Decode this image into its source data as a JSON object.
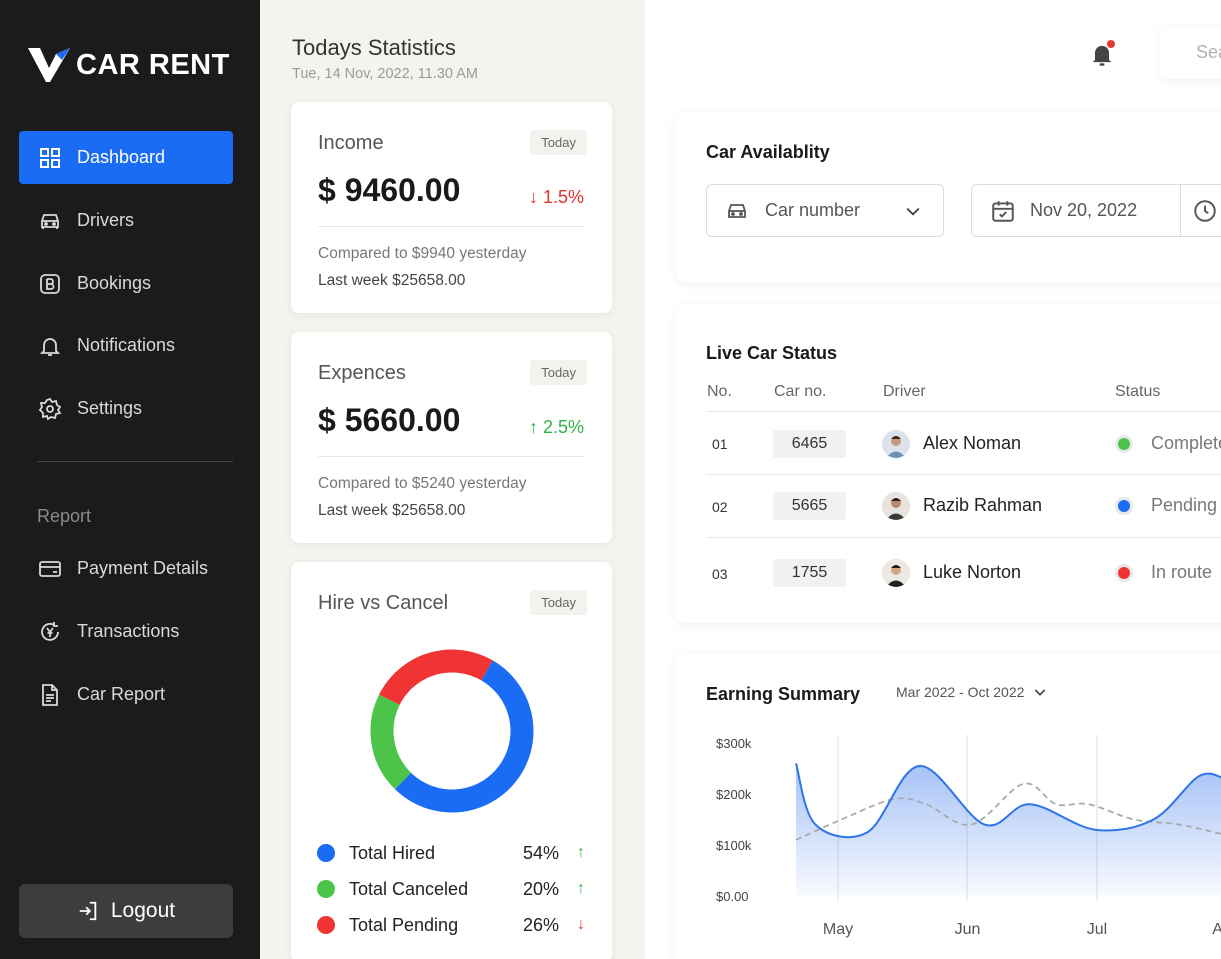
{
  "app": {
    "brand": "CAR RENT"
  },
  "sidebar": {
    "items": [
      {
        "label": "Dashboard",
        "icon": "grid-icon",
        "active": true
      },
      {
        "label": "Drivers",
        "icon": "car-icon"
      },
      {
        "label": "Bookings",
        "icon": "bookings-icon"
      },
      {
        "label": "Notifications",
        "icon": "bell-icon"
      },
      {
        "label": "Settings",
        "icon": "gear-icon"
      }
    ],
    "report_label": "Report",
    "report_items": [
      {
        "label": "Payment Details",
        "icon": "wallet-icon"
      },
      {
        "label": "Transactions",
        "icon": "yen-coin-icon"
      },
      {
        "label": "Car Report",
        "icon": "document-icon"
      }
    ],
    "logout_label": "Logout"
  },
  "stats": {
    "title": "Todays Statistics",
    "date": "Tue, 14 Nov, 2022, 11.30 AM",
    "income": {
      "title": "Income",
      "badge": "Today",
      "amount": "$ 9460.00",
      "change": "↓ 1.5%",
      "direction": "down",
      "compare": "Compared to $9940 yesterday",
      "last_week": "Last week $25658.00"
    },
    "expenses": {
      "title": "Expences",
      "badge": "Today",
      "amount": "$ 5660.00",
      "change": "↑ 2.5%",
      "direction": "up",
      "compare": "Compared to $5240 yesterday",
      "last_week": "Last week $25658.00"
    },
    "hire_cancel": {
      "title": "Hire vs Cancel",
      "badge": "Today",
      "legend": [
        {
          "label": "Total Hired",
          "pct": "54%",
          "arrow": "↑",
          "color": "#1a6cf5",
          "value": 54,
          "arrow_color": "#2fb344"
        },
        {
          "label": "Total Canceled",
          "pct": "20%",
          "arrow": "↑",
          "color": "#4cc44a",
          "value": 20,
          "arrow_color": "#2fb344"
        },
        {
          "label": "Total Pending",
          "pct": "26%",
          "arrow": "↓",
          "color": "#f03434",
          "value": 26,
          "arrow_color": "#e03131"
        }
      ]
    }
  },
  "topbar": {
    "search_placeholder": "Search"
  },
  "availability": {
    "title": "Car Availablity",
    "car_select": "Car number",
    "date": "Nov 20, 2022"
  },
  "live_status": {
    "title": "Live Car Status",
    "headers": {
      "no": "No.",
      "car": "Car no.",
      "driver": "Driver",
      "status": "Status"
    },
    "rows": [
      {
        "no": "01",
        "car": "6465",
        "driver": "Alex Noman",
        "status": "Completed",
        "color": "#4cc44a"
      },
      {
        "no": "02",
        "car": "5665",
        "driver": "Razib Rahman",
        "status": "Pending",
        "color": "#1a6cf5"
      },
      {
        "no": "03",
        "car": "1755",
        "driver": "Luke Norton",
        "status": "In route",
        "color": "#f03434"
      }
    ]
  },
  "chart_data": {
    "type": "area",
    "title": "Earning Summary",
    "period": "Mar 2022 - Oct 2022",
    "yticks": [
      "$300k",
      "$200k",
      "$100k",
      "$0.00"
    ],
    "ylim": [
      0,
      300000
    ],
    "xticks": [
      "May",
      "Jun",
      "Jul",
      "Aug"
    ],
    "series": [
      {
        "style": "solid-area",
        "color": "#2f74e8",
        "points": [
          [
            0,
            260000
          ],
          [
            0.15,
            140000
          ],
          [
            0.55,
            125000
          ],
          [
            0.95,
            255000
          ],
          [
            1.45,
            140000
          ],
          [
            1.8,
            180000
          ],
          [
            2.3,
            130000
          ],
          [
            2.75,
            150000
          ],
          [
            3.1,
            235000
          ],
          [
            3.3,
            230000
          ]
        ]
      },
      {
        "style": "dashed",
        "color": "#aaaaaa",
        "points": [
          [
            0,
            110000
          ],
          [
            0.35,
            150000
          ],
          [
            0.75,
            190000
          ],
          [
            1.0,
            180000
          ],
          [
            1.35,
            140000
          ],
          [
            1.75,
            220000
          ],
          [
            2.0,
            180000
          ],
          [
            2.25,
            180000
          ],
          [
            2.6,
            150000
          ],
          [
            2.95,
            140000
          ],
          [
            3.3,
            120000
          ]
        ]
      }
    ]
  }
}
